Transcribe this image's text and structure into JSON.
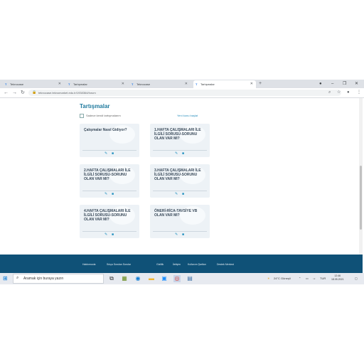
{
  "browser": {
    "tabs": [
      {
        "favicon": "T",
        "title": "Teknocase"
      },
      {
        "favicon": "T",
        "title": "Tartışmalar"
      },
      {
        "favicon": "T",
        "title": "Teknocase"
      },
      {
        "favicon": "T",
        "title": "Tartışmalar"
      }
    ],
    "new_tab": "+",
    "url": "teknocase.teknomarket.edu.tr/1938364/forum"
  },
  "page": {
    "title": "Tartışmalar",
    "checkbox_label": "Sadece kendi tartışmalarım",
    "right_link": "Yeni konu başlat",
    "cards": [
      {
        "title": "Çalışmalar Nasıl Gidiyor?"
      },
      {
        "title": "1.HAFTA ÇALIŞMALARI İLE İLGİLİ SORUSU-SORUNU OLAN VAR MI?"
      },
      {
        "title": "2.HAFTA ÇALIŞMALARI İLE İLGİLİ SORUSU-SORUNU OLAN VAR MI?"
      },
      {
        "title": "3.HAFTA ÇALIŞMALARI İLE İLGİLİ SORUSU-SORUNU OLAN VAR MI?"
      },
      {
        "title": "4.HAFTA ÇALIŞMALARI İLE İLGİLİ SORUSU-SORUNU OLAN VAR MI?"
      },
      {
        "title": "ÖNERİ-RİCA-TAVSİYE VB OLAN VAR MI?"
      }
    ]
  },
  "footer": {
    "links": [
      "Hakkımızda",
      "Sıkça Sorulan Sorular",
      "Gizlilik",
      "İletişim",
      "Kullanım Şartları",
      "Destek Merkezi"
    ]
  },
  "taskbar": {
    "search_placeholder": "Aramak için buraya yazın",
    "weather": "24°C Güneşli",
    "language": "TUR",
    "time": "12:46",
    "date": "18.05.2021"
  },
  "colors": {
    "accent": "#1f7a9e",
    "footer_bg": "#0f5177",
    "card_bg": "#edf2f6"
  }
}
